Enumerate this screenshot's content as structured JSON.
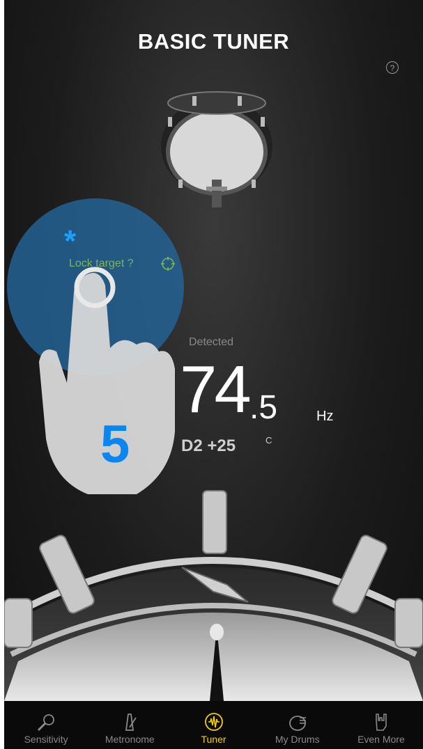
{
  "header": {
    "title": "BASIC TUNER",
    "help_label": "?"
  },
  "overlay": {
    "lock_target_label": "Lock target ?",
    "marker": "*",
    "step_number": "5"
  },
  "reading": {
    "detected_label": "Detected",
    "frequency_whole": "74",
    "frequency_decimal": ".5",
    "unit": "Hz",
    "note": "D2 +25",
    "cents_symbol": "C"
  },
  "tabs": [
    {
      "label": "Sensitivity",
      "icon": "microphone-icon",
      "active": false
    },
    {
      "label": "Metronome",
      "icon": "metronome-icon",
      "active": false
    },
    {
      "label": "Tuner",
      "icon": "tuner-wave-icon",
      "active": true
    },
    {
      "label": "My Drums",
      "icon": "drum-icon",
      "active": false
    },
    {
      "label": "Even More",
      "icon": "rock-hand-icon",
      "active": false
    }
  ],
  "colors": {
    "accent": "#f4d000",
    "overlay_blue": "#2264a0",
    "lock_green": "#7db35a",
    "step_blue": "#0a86f0"
  }
}
